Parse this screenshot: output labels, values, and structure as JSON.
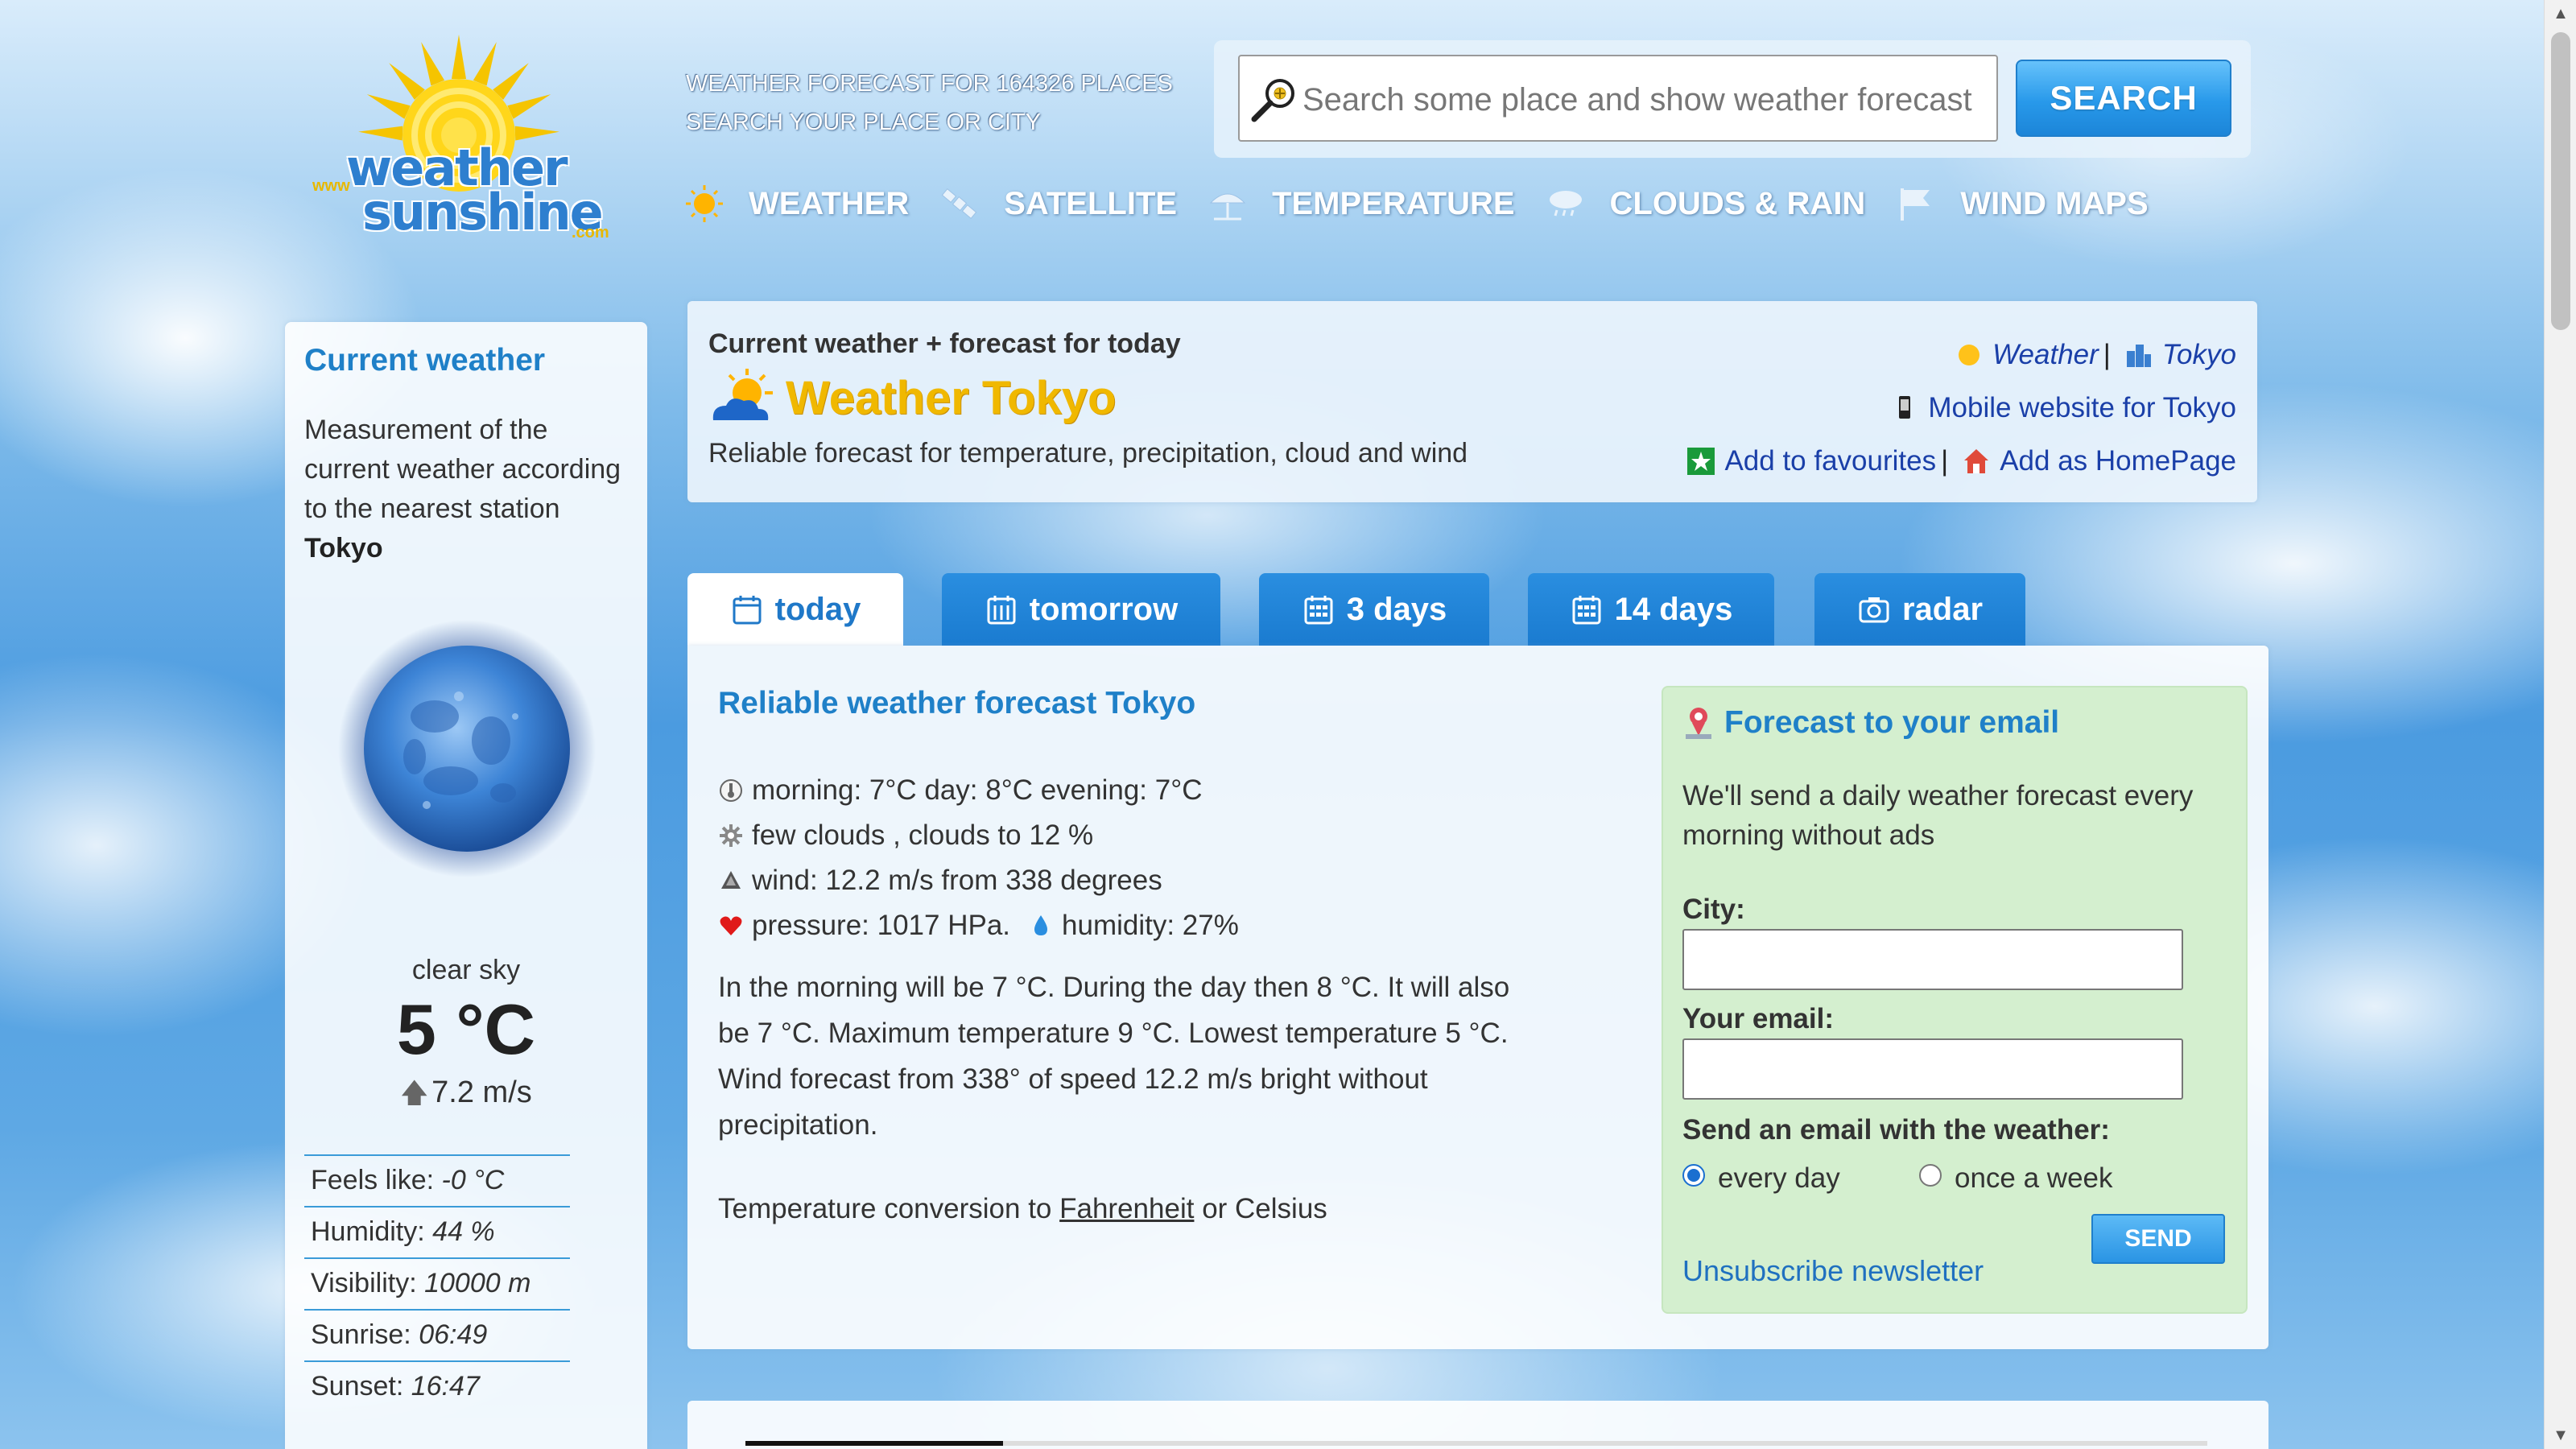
{
  "logo": {
    "www": "www",
    "word1": "weather",
    "word2": "sunshine",
    "com": ".com"
  },
  "tagline": {
    "line1": "WEATHER FORECAST FOR 164326 PLACES",
    "line2": "SEARCH YOUR PLACE OR CITY"
  },
  "search": {
    "placeholder": "Search some place and show weather forecast",
    "button_label": "SEARCH"
  },
  "nav": {
    "items": [
      {
        "label": "WEATHER",
        "icon": "sun-icon"
      },
      {
        "label": "SATELLITE",
        "icon": "satellite-icon"
      },
      {
        "label": "TEMPERATURE",
        "icon": "umbrella-icon"
      },
      {
        "label": "CLOUDS & RAIN",
        "icon": "cloud-rain-icon"
      },
      {
        "label": "WIND MAPS",
        "icon": "flag-icon"
      }
    ]
  },
  "sidebar": {
    "title": "Current weather",
    "desc_prefix": "Measurement of the current weather according to the nearest station",
    "station": "Tokyo",
    "condition": "clear sky",
    "temperature": "5 °C",
    "wind": "7.2 m/s",
    "stats": [
      {
        "label": "Feels like:",
        "value": "-0 °C"
      },
      {
        "label": "Humidity:",
        "value": "44 %"
      },
      {
        "label": "Visibility:",
        "value": "10000 m"
      },
      {
        "label": "Sunrise:",
        "value": "06:49"
      },
      {
        "label": "Sunset:",
        "value": "16:47"
      }
    ]
  },
  "header": {
    "subtitle": "Current weather + forecast for today",
    "title": "Weather Tokyo",
    "tagline": "Reliable forecast for temperature, precipitation, cloud and wind",
    "breadcrumb_weather": "Weather",
    "breadcrumb_sep": "|",
    "breadcrumb_city": "Tokyo",
    "mobile_link": "Mobile website for Tokyo",
    "favourites_link": "Add to favourites",
    "homepage_link": "Add as HomePage"
  },
  "tabs": [
    {
      "label": "today",
      "active": true
    },
    {
      "label": "tomorrow"
    },
    {
      "label": "3 days"
    },
    {
      "label": "14 days"
    },
    {
      "label": "radar"
    }
  ],
  "forecast": {
    "title": "Reliable weather forecast Tokyo",
    "temps_line": "morning: 7°C day: 8°C evening: 7°C",
    "clouds_line": "few clouds , clouds to 12 %",
    "wind_line": "wind: 12.2 m/s from 338 degrees",
    "pressure_line": "pressure: 1017 HPa.",
    "humidity_line": "humidity: 27%",
    "text": "In the morning will be 7 °C. During the day then 8 °C. It will also be 7 °C. Maximum temperature 9 °C. Lowest temperature 5 °C. Wind forecast from 338° of speed 12.2 m/s bright without precipitation.",
    "conversion_prefix": "Temperature conversion to",
    "conversion_link": "Fahrenheit",
    "conversion_suffix": "or Celsius"
  },
  "email": {
    "title": "Forecast to your email",
    "description": "We'll send a daily weather forecast every morning without ads",
    "city_label": "City:",
    "email_label": "Your email:",
    "frequency_label": "Send an email with the weather:",
    "option_daily": "every day",
    "option_weekly": "once a week",
    "send_label": "SEND",
    "unsubscribe": "Unsubscribe newsletter"
  },
  "colors": {
    "accent": "#1f80c8",
    "title_yellow": "#f0b800",
    "tab_blue": "#1a7bd0",
    "email_bg": "#d4efcf"
  }
}
